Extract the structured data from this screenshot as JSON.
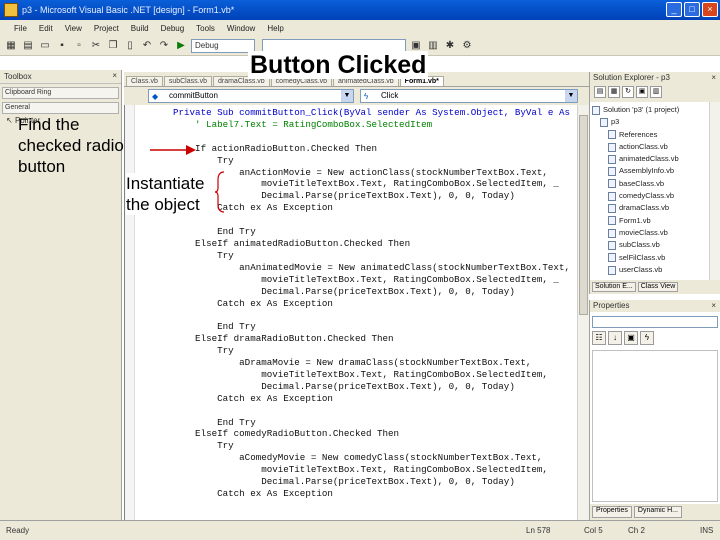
{
  "window": {
    "title": "p3 - Microsoft Visual Basic .NET [design] - Form1.vb*",
    "buttons": [
      "_",
      "□",
      "×"
    ]
  },
  "menubar": [
    "File",
    "Edit",
    "View",
    "Project",
    "Build",
    "Debug",
    "Tools",
    "Window",
    "Help"
  ],
  "toolbar": {
    "config_value": "Debug",
    "find_value": ""
  },
  "slide_title": "Button Clicked",
  "toolbox": {
    "header": "Toolbox",
    "sections": [
      "Clipboard Ring",
      "General"
    ],
    "pointer": "Pointer"
  },
  "callouts": {
    "find": [
      "Find the",
      "checked radio",
      "button"
    ],
    "instantiate": [
      "Instantiate",
      "the object"
    ]
  },
  "doc_tabs": [
    "Class.vb",
    "subClass.vb",
    "dramaClass.vb",
    "comedyClass.vb",
    "animatedClass.vb",
    "Form1.vb*"
  ],
  "editor": {
    "object_combo": "commitButton",
    "event_combo": "Click",
    "code_lines": [
      {
        "t": "Private Sub commitButton_Click(ByVal sender As System.Object, ByVal e As",
        "k": "kw"
      },
      {
        "t": "    ' Label7.Text = RatingComboBox.SelectedItem",
        "k": "cm"
      },
      {
        "t": "",
        "k": ""
      },
      {
        "t": "    If actionRadioButton.Checked Then",
        "k": ""
      },
      {
        "t": "        Try",
        "k": ""
      },
      {
        "t": "            anActionMovie = New actionClass(stockNumberTextBox.Text,",
        "k": ""
      },
      {
        "t": "                movieTitleTextBox.Text, RatingComboBox.SelectedItem, _",
        "k": ""
      },
      {
        "t": "                Decimal.Parse(priceTextBox.Text), 0, 0, Today)",
        "k": ""
      },
      {
        "t": "        Catch ex As Exception",
        "k": ""
      },
      {
        "t": "",
        "k": ""
      },
      {
        "t": "        End Try",
        "k": ""
      },
      {
        "t": "    ElseIf animatedRadioButton.Checked Then",
        "k": ""
      },
      {
        "t": "        Try",
        "k": ""
      },
      {
        "t": "            anAnimatedMovie = New animatedClass(stockNumberTextBox.Text,",
        "k": ""
      },
      {
        "t": "                movieTitleTextBox.Text, RatingComboBox.SelectedItem, _",
        "k": ""
      },
      {
        "t": "                Decimal.Parse(priceTextBox.Text), 0, 0, Today)",
        "k": ""
      },
      {
        "t": "        Catch ex As Exception",
        "k": ""
      },
      {
        "t": "",
        "k": ""
      },
      {
        "t": "        End Try",
        "k": ""
      },
      {
        "t": "    ElseIf dramaRadioButton.Checked Then",
        "k": ""
      },
      {
        "t": "        Try",
        "k": ""
      },
      {
        "t": "            aDramaMovie = New dramaClass(stockNumberTextBox.Text,",
        "k": ""
      },
      {
        "t": "                movieTitleTextBox.Text, RatingComboBox.SelectedItem,",
        "k": ""
      },
      {
        "t": "                Decimal.Parse(priceTextBox.Text), 0, 0, Today)",
        "k": ""
      },
      {
        "t": "        Catch ex As Exception",
        "k": ""
      },
      {
        "t": "",
        "k": ""
      },
      {
        "t": "        End Try",
        "k": ""
      },
      {
        "t": "    ElseIf comedyRadioButton.Checked Then",
        "k": ""
      },
      {
        "t": "        Try",
        "k": ""
      },
      {
        "t": "            aComedyMovie = New comedyClass(stockNumberTextBox.Text,",
        "k": ""
      },
      {
        "t": "                movieTitleTextBox.Text, RatingComboBox.SelectedItem,",
        "k": ""
      },
      {
        "t": "                Decimal.Parse(priceTextBox.Text), 0, 0, Today)",
        "k": ""
      },
      {
        "t": "        Catch ex As Exception",
        "k": ""
      }
    ]
  },
  "solution_explorer": {
    "header": "Solution Explorer - p3",
    "items": [
      "Solution 'p3' (1 project)",
      "p3",
      "References",
      "actionClass.vb",
      "animatedClass.vb",
      "AssemblyInfo.vb",
      "baseClass.vb",
      "comedyClass.vb",
      "dramaClass.vb",
      "Form1.vb",
      "movieClass.vb",
      "subClass.vb",
      "selFilClass.vb",
      "userClass.vb"
    ],
    "tabs": [
      "Solution E...",
      "Class View"
    ]
  },
  "properties": {
    "header": "Properties",
    "tabs": [
      "Properties",
      "Dynamic H..."
    ]
  },
  "statusbar": {
    "status": "Ready",
    "line": "Ln 578",
    "col": "Col 5",
    "ch": "Ch 2",
    "mode": "INS"
  }
}
